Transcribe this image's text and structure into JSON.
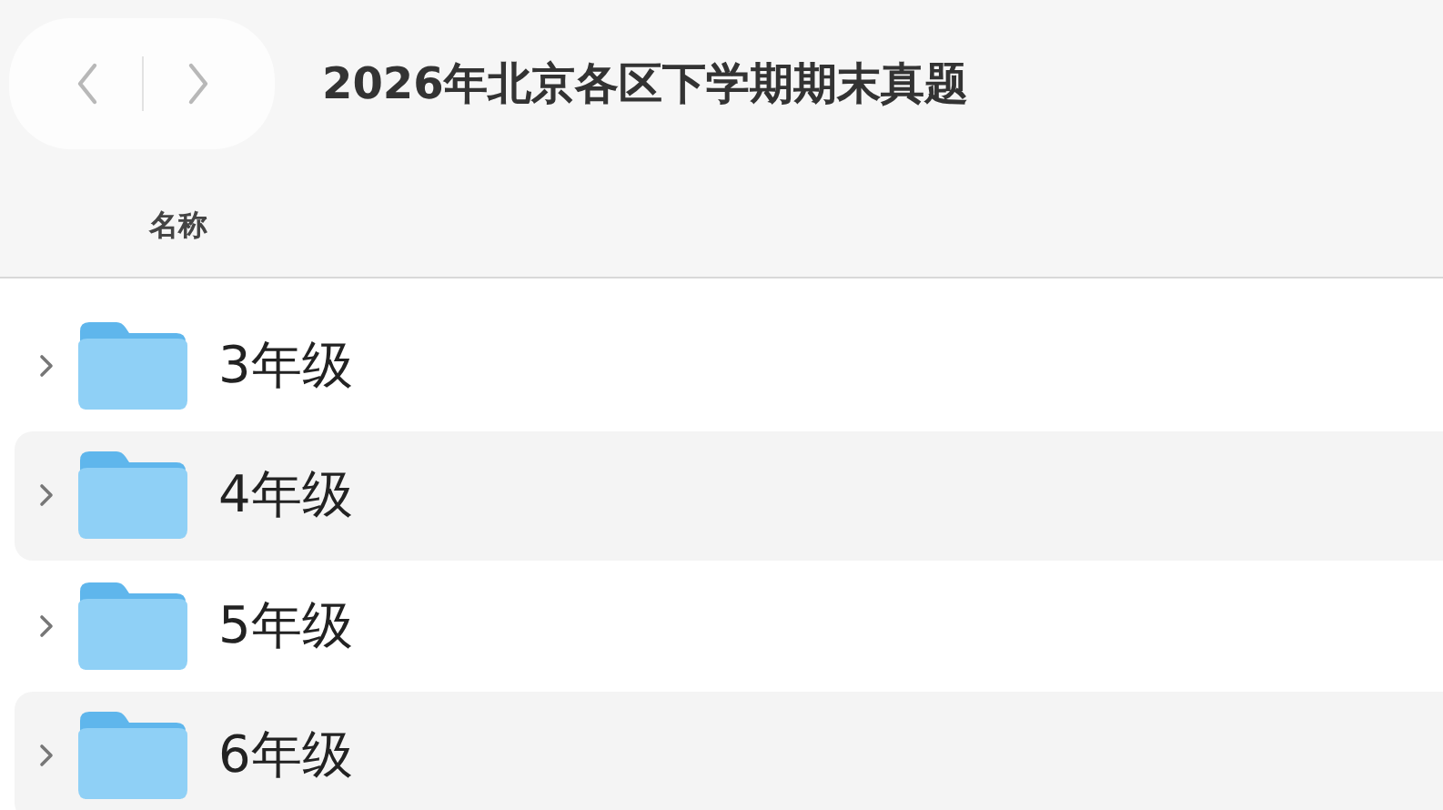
{
  "window": {
    "title": "2026年北京各区下学期期末真题"
  },
  "navigation": [
    {
      "kind": "back",
      "disabled": true
    },
    {
      "kind": "forward",
      "disabled": true
    }
  ],
  "table": {
    "columns": [
      "名称"
    ],
    "rows": [
      {
        "name": "3年级",
        "expanded": false
      },
      {
        "name": "4年级",
        "expanded": false
      },
      {
        "name": "5年级",
        "expanded": false
      },
      {
        "name": "6年级",
        "expanded": false
      }
    ]
  }
}
